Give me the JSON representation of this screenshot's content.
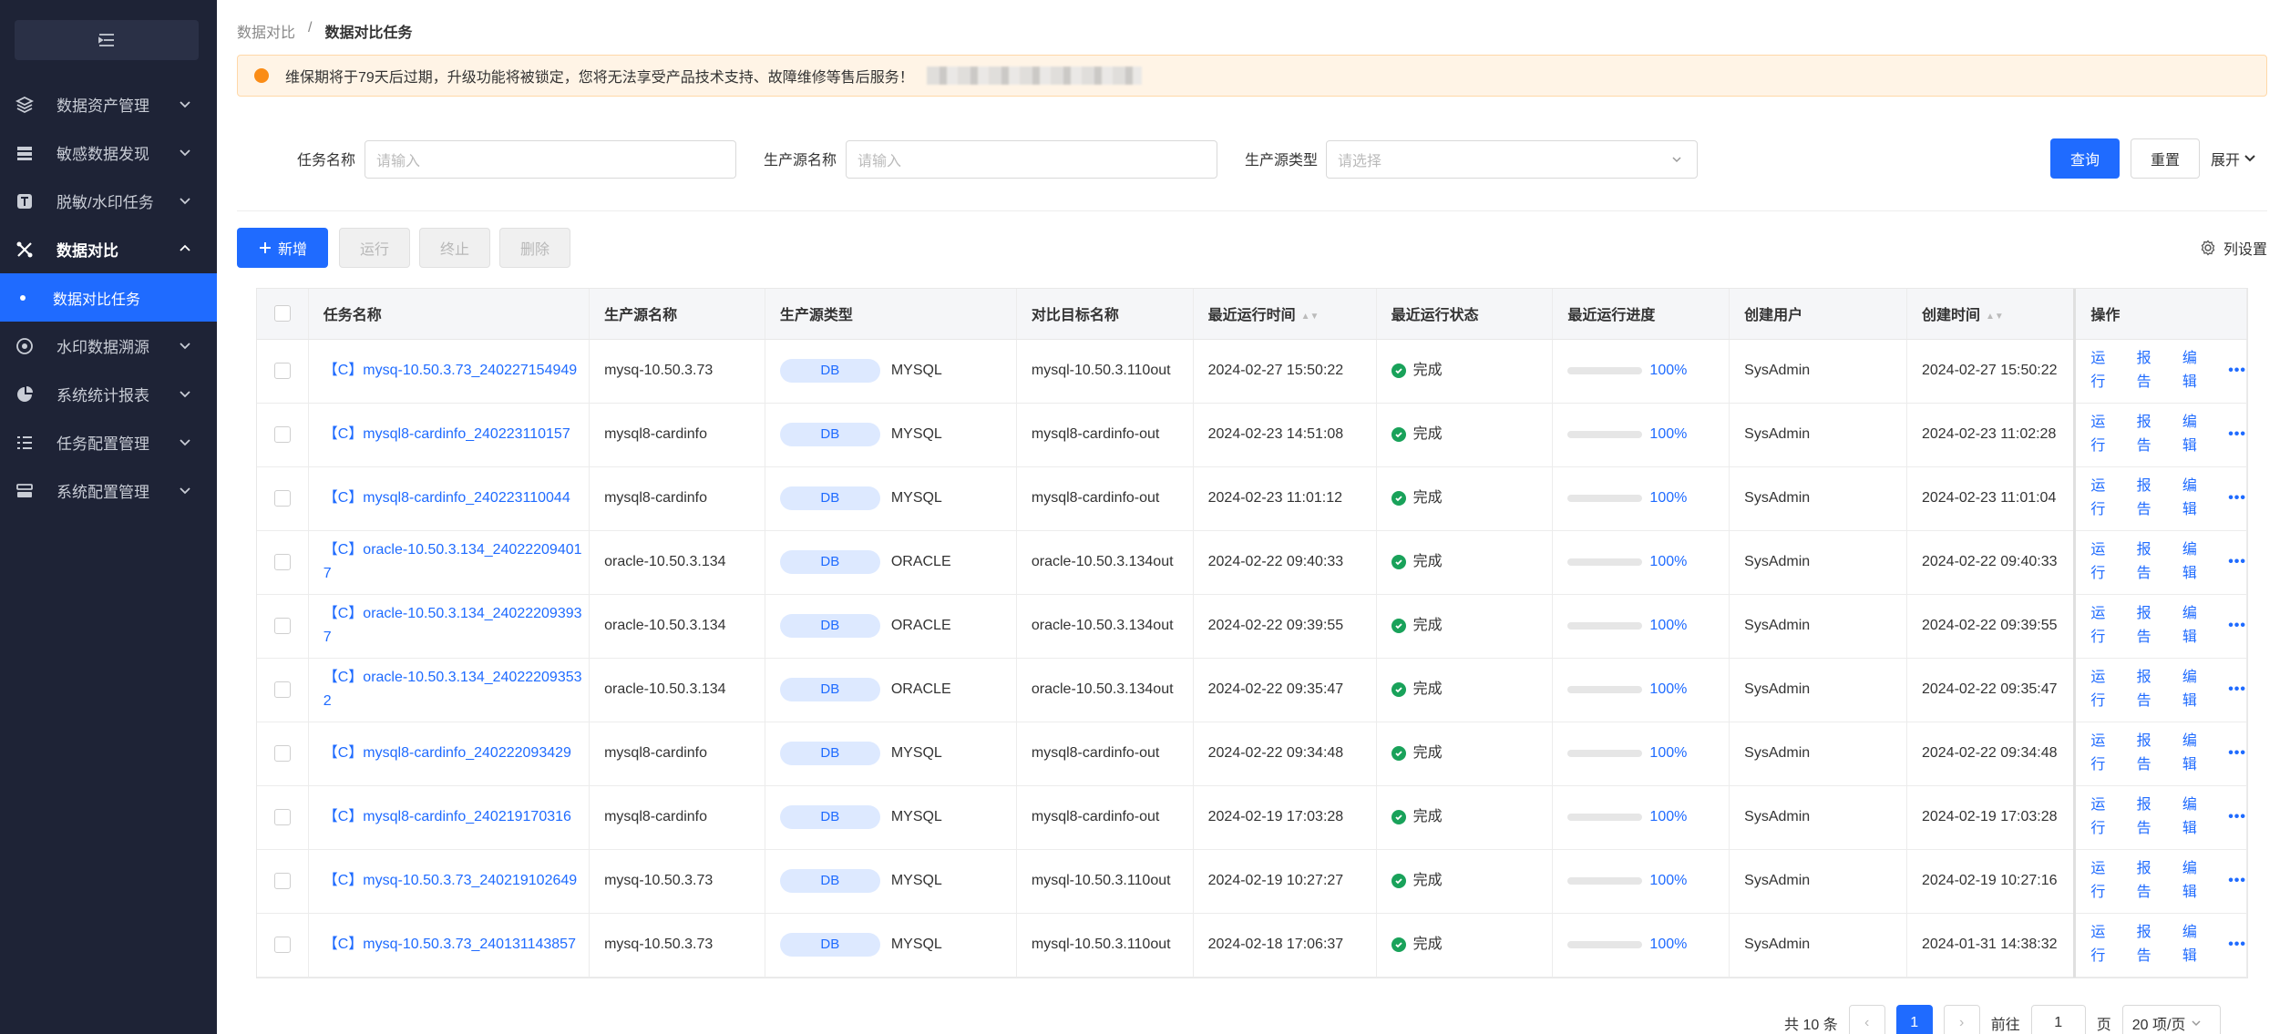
{
  "sidebar": {
    "items": [
      {
        "label": "数据资产管理",
        "icon": "layers-icon"
      },
      {
        "label": "敏感数据发现",
        "icon": "server-icon"
      },
      {
        "label": "脱敏/水印任务",
        "icon": "t-box-icon"
      },
      {
        "label": "数据对比",
        "icon": "compare-icon"
      },
      {
        "label": "水印数据溯源",
        "icon": "target-icon"
      },
      {
        "label": "系统统计报表",
        "icon": "pie-chart-icon"
      },
      {
        "label": "任务配置管理",
        "icon": "list-icon"
      },
      {
        "label": "系统配置管理",
        "icon": "settings-box-icon"
      }
    ],
    "active_sub": "数据对比任务"
  },
  "breadcrumb": {
    "parent": "数据对比",
    "sep": "/",
    "current": "数据对比任务"
  },
  "notice": {
    "text": "维保期将于79天后过期，升级功能将被锁定，您将无法享受产品技术支持、故障维修等售后服务！",
    "color": "#fa8c16"
  },
  "filters": {
    "task_name_label": "任务名称",
    "task_name_placeholder": "请输入",
    "source_name_label": "生产源名称",
    "source_name_placeholder": "请输入",
    "source_type_label": "生产源类型",
    "source_type_placeholder": "请选择",
    "query": "查询",
    "reset": "重置",
    "expand": "展开"
  },
  "toolbar": {
    "add": "新增",
    "run": "运行",
    "stop": "终止",
    "delete": "删除",
    "columns": "列设置"
  },
  "table": {
    "headers": [
      "任务名称",
      "生产源名称",
      "生产源类型",
      "对比目标名称",
      "最近运行时间",
      "最近运行状态",
      "最近运行进度",
      "创建用户",
      "创建时间",
      "操作"
    ],
    "tag": "DB",
    "actions": [
      "运行",
      "报告",
      "编辑"
    ],
    "rows": [
      {
        "name": "【C】mysq-10.50.3.73_240227154949",
        "source": "mysq-10.50.3.73",
        "type": "MYSQL",
        "target": "mysql-10.50.3.110out",
        "last_run": "2024-02-27 15:50:22",
        "status": "完成",
        "progress": "100%",
        "progress_value": 1.0,
        "user": "SysAdmin",
        "created": "2024-02-27 15:50:22"
      },
      {
        "name": "【C】mysql8-cardinfo_240223110157",
        "source": "mysql8-cardinfo",
        "type": "MYSQL",
        "target": "mysql8-cardinfo-out",
        "last_run": "2024-02-23 14:51:08",
        "status": "完成",
        "progress": "100%",
        "progress_value": 1.0,
        "user": "SysAdmin",
        "created": "2024-02-23 11:02:28"
      },
      {
        "name": "【C】mysql8-cardinfo_240223110044",
        "source": "mysql8-cardinfo",
        "type": "MYSQL",
        "target": "mysql8-cardinfo-out",
        "last_run": "2024-02-23 11:01:12",
        "status": "完成",
        "progress": "100%",
        "progress_value": 1.0,
        "user": "SysAdmin",
        "created": "2024-02-23 11:01:04"
      },
      {
        "name": "【C】oracle-10.50.3.134_240222094017",
        "source": "oracle-10.50.3.134",
        "type": "ORACLE",
        "target": "oracle-10.50.3.134out",
        "last_run": "2024-02-22 09:40:33",
        "status": "完成",
        "progress": "100%",
        "progress_value": 1.0,
        "user": "SysAdmin",
        "created": "2024-02-22 09:40:33"
      },
      {
        "name": "【C】oracle-10.50.3.134_240222093937",
        "source": "oracle-10.50.3.134",
        "type": "ORACLE",
        "target": "oracle-10.50.3.134out",
        "last_run": "2024-02-22 09:39:55",
        "status": "完成",
        "progress": "100%",
        "progress_value": 1.0,
        "user": "SysAdmin",
        "created": "2024-02-22 09:39:55"
      },
      {
        "name": "【C】oracle-10.50.3.134_240222093532",
        "source": "oracle-10.50.3.134",
        "type": "ORACLE",
        "target": "oracle-10.50.3.134out",
        "last_run": "2024-02-22 09:35:47",
        "status": "完成",
        "progress": "100%",
        "progress_value": 1.0,
        "user": "SysAdmin",
        "created": "2024-02-22 09:35:47"
      },
      {
        "name": "【C】mysql8-cardinfo_240222093429",
        "source": "mysql8-cardinfo",
        "type": "MYSQL",
        "target": "mysql8-cardinfo-out",
        "last_run": "2024-02-22 09:34:48",
        "status": "完成",
        "progress": "100%",
        "progress_value": 1.0,
        "user": "SysAdmin",
        "created": "2024-02-22 09:34:48"
      },
      {
        "name": "【C】mysql8-cardinfo_240219170316",
        "source": "mysql8-cardinfo",
        "type": "MYSQL",
        "target": "mysql8-cardinfo-out",
        "last_run": "2024-02-19 17:03:28",
        "status": "完成",
        "progress": "100%",
        "progress_value": 1.0,
        "user": "SysAdmin",
        "created": "2024-02-19 17:03:28"
      },
      {
        "name": "【C】mysq-10.50.3.73_240219102649",
        "source": "mysq-10.50.3.73",
        "type": "MYSQL",
        "target": "mysql-10.50.3.110out",
        "last_run": "2024-02-19 10:27:27",
        "status": "完成",
        "progress": "100%",
        "progress_value": 1.0,
        "user": "SysAdmin",
        "created": "2024-02-19 10:27:16"
      },
      {
        "name": "【C】mysq-10.50.3.73_240131143857",
        "source": "mysq-10.50.3.73",
        "type": "MYSQL",
        "target": "mysql-10.50.3.110out",
        "last_run": "2024-02-18 17:06:37",
        "status": "完成",
        "progress": "100%",
        "progress_value": 1.0,
        "user": "SysAdmin",
        "created": "2024-01-31 14:38:32"
      }
    ]
  },
  "pagination": {
    "total": "共 10 条",
    "current_page": "1",
    "goto_label": "前往",
    "goto_value": "1",
    "page_unit": "页",
    "page_size": "20 项/页"
  },
  "colors": {
    "primary": "#1f6bff",
    "sidebar_bg": "#1e2336",
    "success": "#19a25a",
    "warning": "#fa8c16"
  }
}
